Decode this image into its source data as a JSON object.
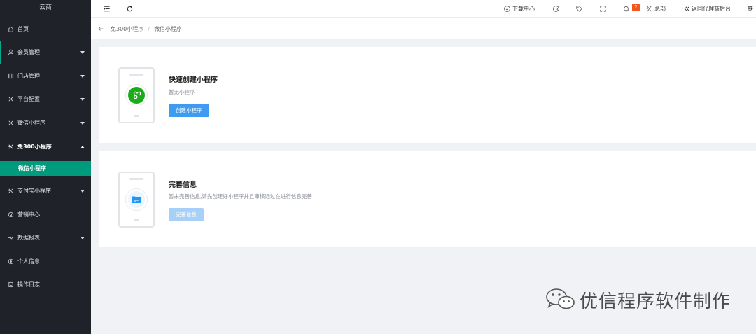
{
  "sidebar": {
    "brand": "云商",
    "items": [
      {
        "label": "首页",
        "icon": "home-icon"
      },
      {
        "label": "会员管理",
        "icon": "user-icon"
      },
      {
        "label": "门店管理",
        "icon": "store-icon"
      },
      {
        "label": "平台配置",
        "icon": "config-icon"
      },
      {
        "label": "微信小程序",
        "icon": "wechat-mini-icon"
      },
      {
        "label": "免300小程序",
        "icon": "free-mini-icon"
      },
      {
        "label": "支付宝小程序",
        "icon": "alipay-mini-icon"
      },
      {
        "label": "营销中心",
        "icon": "marketing-icon"
      },
      {
        "label": "数据报表",
        "icon": "report-icon"
      },
      {
        "label": "个人信息",
        "icon": "profile-icon"
      },
      {
        "label": "操作日志",
        "icon": "log-icon"
      }
    ],
    "sub_item": "微信小程序"
  },
  "topbar": {
    "download": "下载中心",
    "notification_count": "2",
    "hq": "总部",
    "back_to_agent": "返回代理商后台",
    "truncated": "铁"
  },
  "breadcrumb": {
    "parent": "免300小程序",
    "separator": "/",
    "current": "微信小程序"
  },
  "cards": {
    "create": {
      "title": "快速创建小程序",
      "desc": "暂无小程序",
      "button": "创建小程序"
    },
    "complete": {
      "title": "完善信息",
      "desc": "暂未完善信息,请先创建好小程序并且审核通过在进行信息完善",
      "button": "完善信息"
    }
  },
  "watermark": {
    "text": "优信程序软件制作"
  },
  "colors": {
    "sidebar_bg": "#1f2229",
    "active_sub": "#009a7d",
    "primary": "#3f9bf0",
    "badge": "#f5541d",
    "mini_program_green": "#1aad19"
  }
}
